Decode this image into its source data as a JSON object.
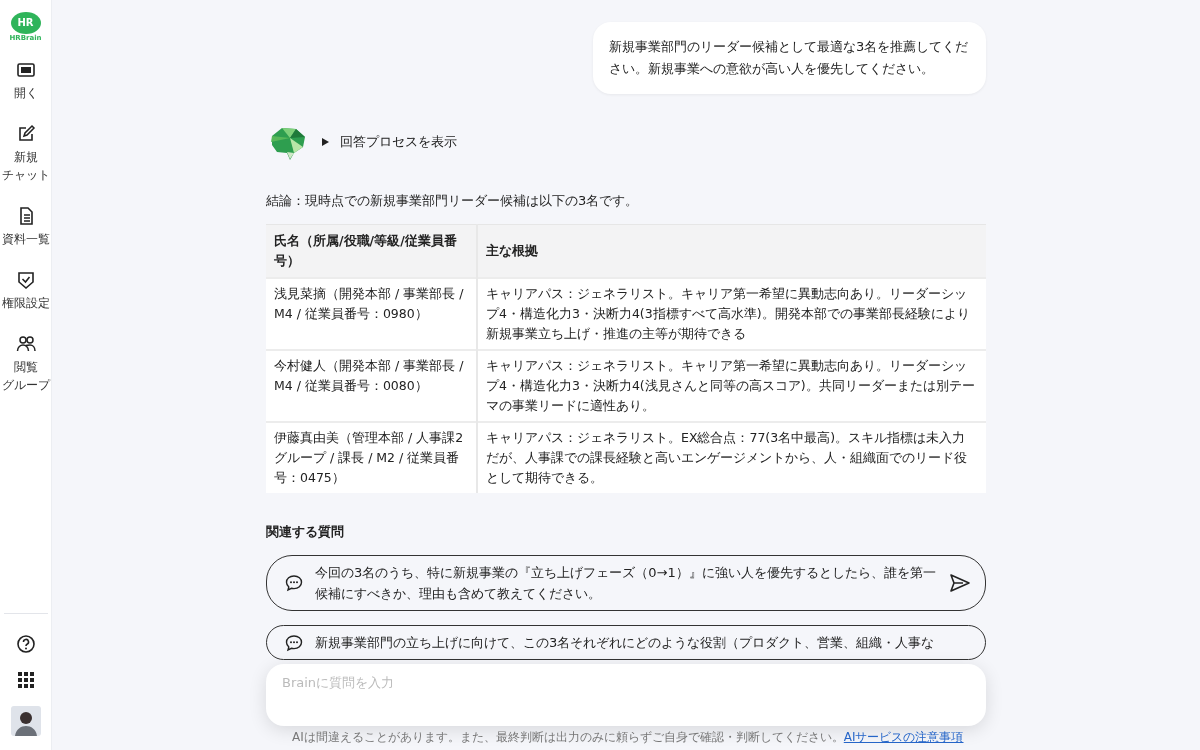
{
  "sidebar": {
    "logo": {
      "mark": "HR",
      "name": "HRBrain"
    },
    "items": [
      {
        "label_lines": [
          "開く"
        ]
      },
      {
        "label_lines": [
          "新規",
          "チャット"
        ]
      },
      {
        "label_lines": [
          "資料一覧"
        ]
      },
      {
        "label_lines": [
          "権限設定"
        ]
      },
      {
        "label_lines": [
          "閲覧",
          "グループ"
        ]
      }
    ]
  },
  "chat": {
    "user_message": "新規事業部門のリーダー候補として最適な3名を推薦してください。新規事業への意欲が高い人を優先してください。",
    "process_toggle": {
      "label": "回答プロセスを表示",
      "expanded": false
    },
    "conclusion": "結論：現時点での新規事業部門リーダー候補は以下の3名です。",
    "table": {
      "columns": [
        "氏名（所属/役職/等級/従業員番号）",
        "主な根拠"
      ],
      "rows": [
        [
          "浅見菜摘（開発本部 / 事業部長 / M4 / 従業員番号：0980）",
          "キャリアパス：ジェネラリスト。キャリア第一希望に異動志向あり。リーダーシップ4・構造化力3・決断力4(3指標すべて高水準)。開発本部での事業部長経験により新規事業立ち上げ・推進の主等が期待できる"
        ],
        [
          "今村健人（開発本部 / 事業部長 / M4 / 従業員番号：0080）",
          "キャリアパス：ジェネラリスト。キャリア第一希望に異動志向あり。リーダーシップ4・構造化力3・決断力4(浅見さんと同等の高スコア)。共同リーダーまたは別テーマの事業リードに適性あり。"
        ],
        [
          "伊藤真由美（管理本部 / 人事課2グループ / 課長 / M2 / 従業員番号：0475）",
          "キャリアパス：ジェネラリスト。EX総合点：77(3名中最高)。スキル指標は未入力だが、人事課での課長経験と高いエンゲージメントから、人・組織面でのリード役として期待できる。"
        ]
      ]
    },
    "related_title": "関連する質問",
    "related_questions": [
      "今回の3名のうち、特に新規事業の『立ち上げフェーズ（0→1）』に強い人を優先するとしたら、誰を第一候補にすべきか、理由も含めて教えてください。",
      "新規事業部門の立ち上げに向けて、この3名それぞれにどのような役割（プロダクト、営業、組織・人事な"
    ]
  },
  "input": {
    "placeholder": "Brainに質問を入力"
  },
  "disclaimer": {
    "text": "AIは間違えることがあります。また、最終判断は出力のみに頼らずご自身で確認・判断してください。",
    "link": "AIサービスの注意事項"
  }
}
